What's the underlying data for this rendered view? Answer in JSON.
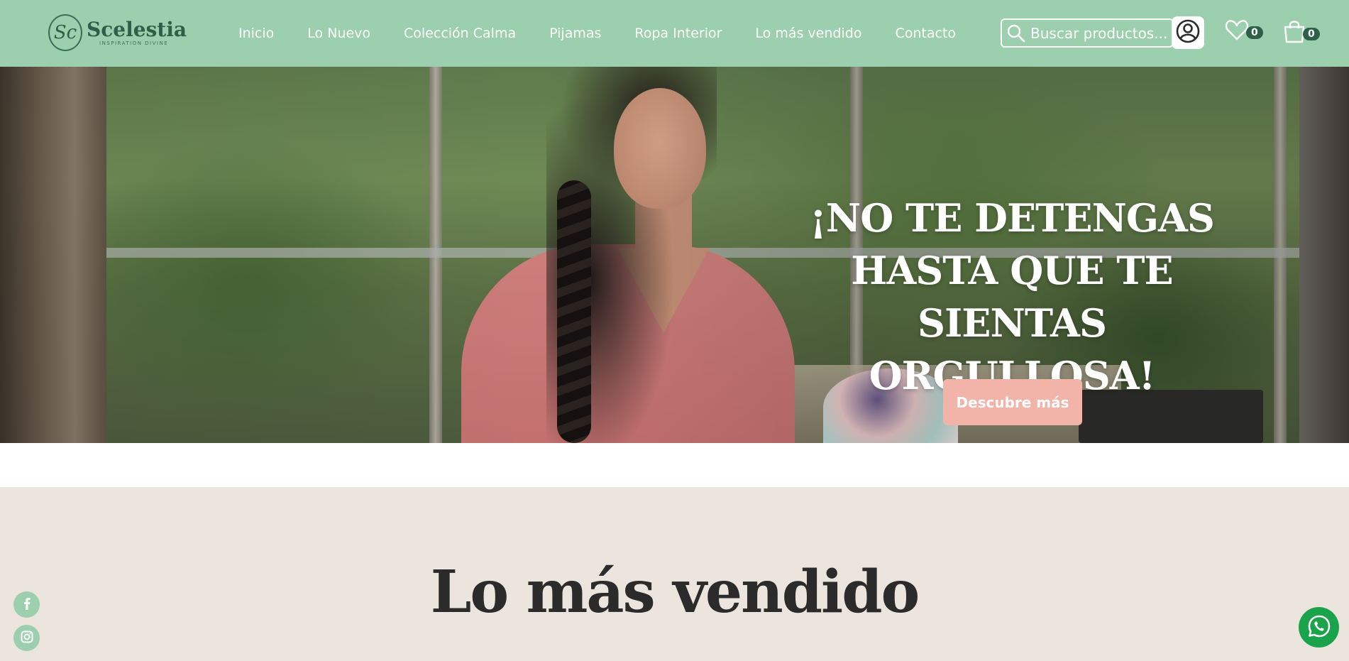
{
  "header": {
    "logo_mark": "Sc",
    "logo_name": "Scelestia",
    "logo_tagline": "INSPIRATION DIVINE",
    "nav": [
      {
        "label": "Inicio"
      },
      {
        "label": "Lo Nuevo"
      },
      {
        "label": "Colección Calma"
      },
      {
        "label": "Pijamas"
      },
      {
        "label": "Ropa Interior"
      },
      {
        "label": "Lo más vendido"
      },
      {
        "label": "Contacto"
      }
    ],
    "search": {
      "placeholder": "Buscar productos..."
    },
    "wishlist_count": "0",
    "cart_count": "0"
  },
  "hero": {
    "title": "¡NO TE DETENGAS HASTA QUE TE SIENTAS ORGULLOSA!",
    "button_label": "Descubre más"
  },
  "section": {
    "title": "Lo más vendido"
  },
  "icons": [
    "search-icon",
    "user-icon",
    "heart-icon",
    "shopping-bag-icon",
    "facebook-icon",
    "instagram-icon",
    "whatsapp-icon"
  ],
  "colors": {
    "header_bg": "#9ccfae",
    "brand_dark": "#2f5f49",
    "button": "#f2b3a9",
    "section_bg": "#ebe5dd",
    "whatsapp": "#1aa34a"
  }
}
